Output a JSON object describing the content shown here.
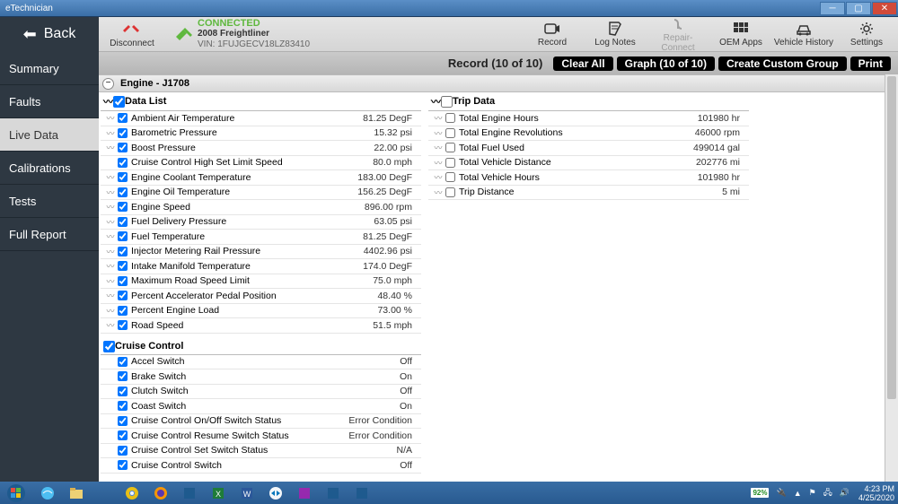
{
  "window": {
    "title": "eTechnician"
  },
  "back_label": "Back",
  "disconnect_label": "Disconnect",
  "connection": {
    "status": "CONNECTED",
    "vehicle": "2008 Freightliner",
    "vin": "VIN: 1FUJGECV18LZ83410"
  },
  "toolbar": [
    {
      "id": "record",
      "label": "Record",
      "disabled": false
    },
    {
      "id": "log-notes",
      "label": "Log Notes",
      "disabled": false
    },
    {
      "id": "repair-connect",
      "label": "Repair-Connect",
      "disabled": true
    },
    {
      "id": "oem-apps",
      "label": "OEM Apps",
      "disabled": false
    },
    {
      "id": "vehicle-history",
      "label": "Vehicle History",
      "disabled": false
    },
    {
      "id": "settings",
      "label": "Settings",
      "disabled": false
    }
  ],
  "page_title": "Live Data",
  "record_status": "Record (10 of 10)",
  "buttons": {
    "clear_all": "Clear All",
    "graph": "Graph (10 of 10)",
    "create_group": "Create Custom Group",
    "print": "Print"
  },
  "nav": [
    "Summary",
    "Faults",
    "Live Data",
    "Calibrations",
    "Tests",
    "Full Report"
  ],
  "nav_active": "Live Data",
  "section_title": "Engine - J1708",
  "groups": {
    "data_list": {
      "title": "Data List",
      "rows": [
        {
          "n": "Ambient Air Temperature",
          "v": "81.25 DegF"
        },
        {
          "n": "Barometric Pressure",
          "v": "15.32 psi"
        },
        {
          "n": "Boost Pressure",
          "v": "22.00 psi"
        },
        {
          "n": "Cruise Control High Set Limit Speed",
          "v": "80.0 mph",
          "noarr": true
        },
        {
          "n": "Engine Coolant Temperature",
          "v": "183.00 DegF"
        },
        {
          "n": "Engine Oil Temperature",
          "v": "156.25 DegF"
        },
        {
          "n": "Engine Speed",
          "v": "896.00 rpm"
        },
        {
          "n": "Fuel Delivery Pressure",
          "v": "63.05 psi"
        },
        {
          "n": "Fuel Temperature",
          "v": "81.25 DegF"
        },
        {
          "n": "Injector Metering Rail Pressure",
          "v": "4402.96 psi"
        },
        {
          "n": "Intake Manifold Temperature",
          "v": "174.0 DegF"
        },
        {
          "n": "Maximum Road Speed Limit",
          "v": "75.0 mph"
        },
        {
          "n": "Percent Accelerator Pedal Position",
          "v": "48.40 %"
        },
        {
          "n": "Percent Engine Load",
          "v": "73.00 %"
        },
        {
          "n": "Road Speed",
          "v": "51.5 mph"
        }
      ]
    },
    "cruise": {
      "title": "Cruise Control",
      "rows": [
        {
          "n": "Accel Switch",
          "v": "Off"
        },
        {
          "n": "Brake Switch",
          "v": "On"
        },
        {
          "n": "Clutch Switch",
          "v": "Off"
        },
        {
          "n": "Coast Switch",
          "v": "On"
        },
        {
          "n": "Cruise Control On/Off Switch Status",
          "v": "Error Condition"
        },
        {
          "n": "Cruise Control Resume Switch Status",
          "v": "Error Condition"
        },
        {
          "n": "Cruise Control Set Switch Status",
          "v": "N/A"
        },
        {
          "n": "Cruise Control Switch",
          "v": "Off"
        }
      ]
    },
    "trip": {
      "title": "Trip Data",
      "rows": [
        {
          "n": "Total Engine Hours",
          "v": "101980 hr"
        },
        {
          "n": "Total Engine Revolutions",
          "v": "46000 rpm"
        },
        {
          "n": "Total Fuel Used",
          "v": "499014 gal"
        },
        {
          "n": "Total Vehicle Distance",
          "v": "202776 mi"
        },
        {
          "n": "Total Vehicle Hours",
          "v": "101980 hr"
        },
        {
          "n": "Trip Distance",
          "v": "5 mi"
        }
      ]
    }
  },
  "tray": {
    "battery": "92%",
    "time": "4:23 PM",
    "date": "4/25/2020"
  }
}
